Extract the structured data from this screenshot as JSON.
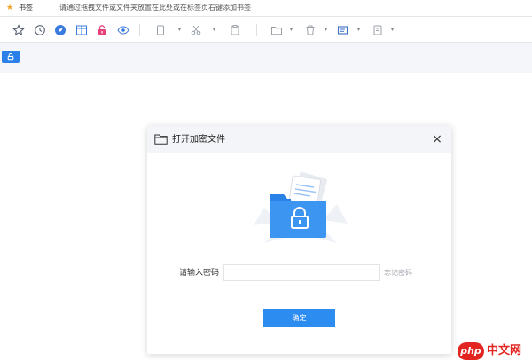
{
  "bookmarks_bar": {
    "title": "书签",
    "hint": "请通过拖拽文件或文件夹放置在此处或在标签页右键添加书签"
  },
  "toolbar": {
    "icons": [
      "star-icon",
      "clock-icon",
      "rocket-icon",
      "split-view-icon",
      "lock-icon",
      "eye-icon",
      "copy-icon",
      "cut-icon",
      "paste-icon",
      "folder-icon",
      "delete-icon",
      "rename-icon",
      "properties-icon"
    ]
  },
  "tab": {
    "icon": "lock-icon"
  },
  "dialog": {
    "title": "打开加密文件",
    "close": "×",
    "password_label": "请输入密码",
    "password_value": "",
    "password_placeholder": "",
    "forgot_link": "忘记密码",
    "confirm_label": "确定"
  },
  "watermark": {
    "brand": "php",
    "site": "中文网"
  },
  "colors": {
    "accent": "#2d8cf0",
    "tab_active": "#2b7fe8",
    "watermark": "#e32522",
    "star": "#f2a22b",
    "lock_pink": "#e8407a"
  }
}
